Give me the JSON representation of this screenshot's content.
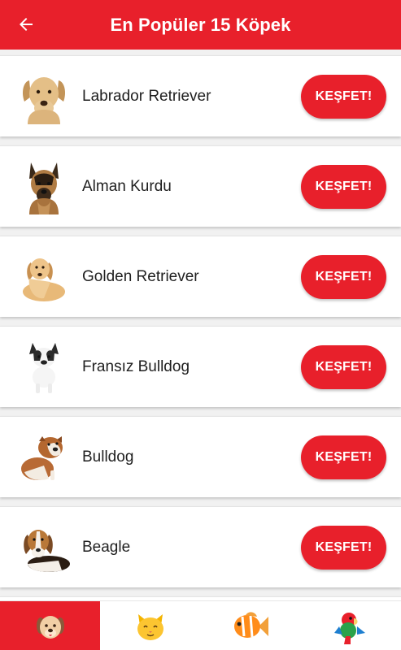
{
  "header": {
    "title": "En Popüler 15 Köpek",
    "back_icon": "arrow-left-icon"
  },
  "colors": {
    "primary": "#e8202b",
    "background": "#f1f1f1",
    "card": "#ffffff"
  },
  "list": {
    "button_label": "KEŞFET!",
    "items": [
      {
        "name": "Labrador Retriever",
        "icon": "labrador-image"
      },
      {
        "name": "Alman Kurdu",
        "icon": "german-shepherd-image"
      },
      {
        "name": "Golden Retriever",
        "icon": "golden-retriever-image"
      },
      {
        "name": "Fransız Bulldog",
        "icon": "french-bulldog-image"
      },
      {
        "name": "Bulldog",
        "icon": "bulldog-image"
      },
      {
        "name": "Beagle",
        "icon": "beagle-image"
      }
    ]
  },
  "bottom_nav": {
    "active": "dog",
    "tabs": [
      {
        "id": "dog",
        "icon": "dog-icon"
      },
      {
        "id": "cat",
        "icon": "cat-icon"
      },
      {
        "id": "fish",
        "icon": "fish-icon"
      },
      {
        "id": "bird",
        "icon": "parrot-icon"
      }
    ]
  }
}
